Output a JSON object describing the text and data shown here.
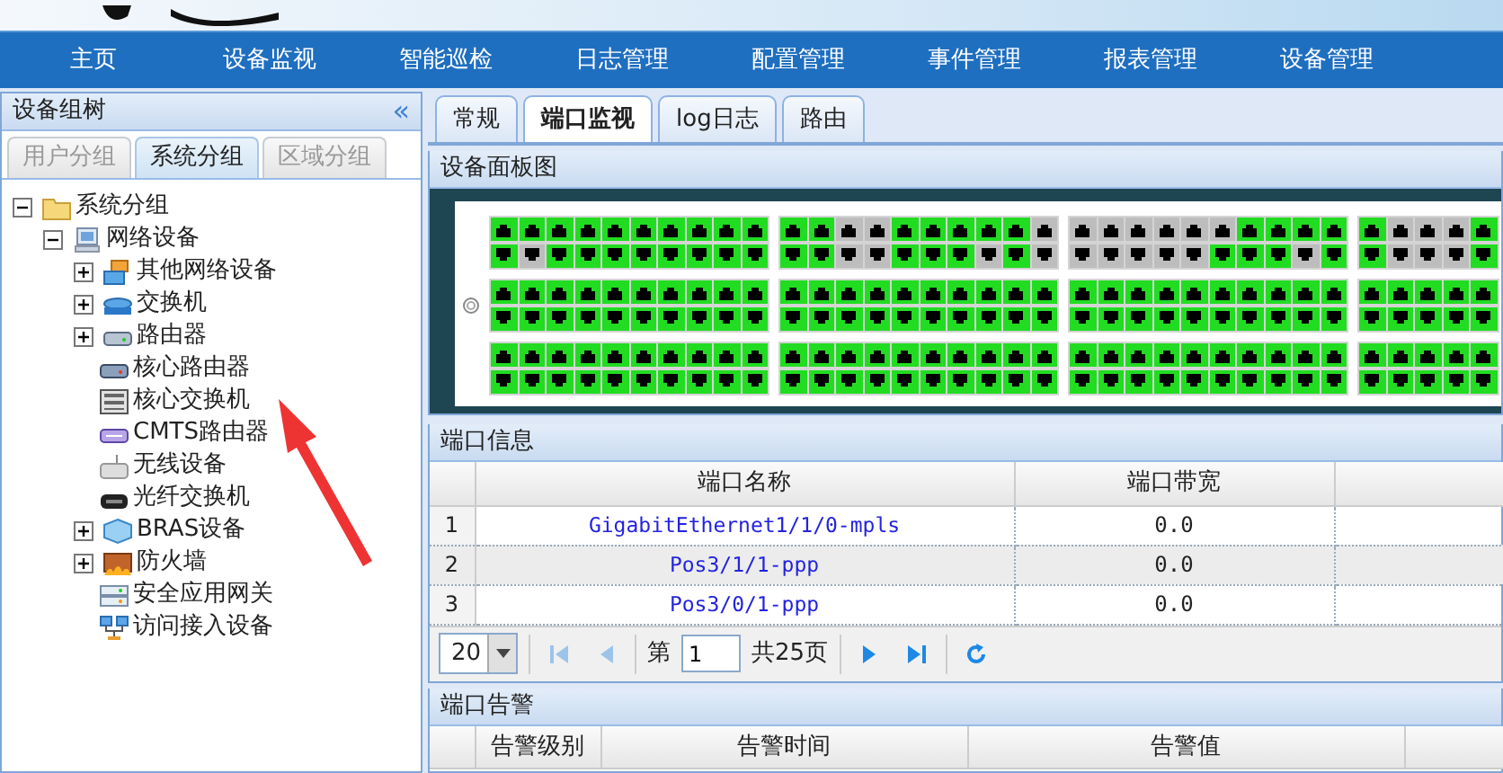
{
  "nav": [
    {
      "label": "主页"
    },
    {
      "label": "设备监视"
    },
    {
      "label": "智能巡检"
    },
    {
      "label": "日志管理"
    },
    {
      "label": "配置管理"
    },
    {
      "label": "事件管理"
    },
    {
      "label": "报表管理"
    },
    {
      "label": "设备管理"
    }
  ],
  "sidebar": {
    "title": "设备组树",
    "collapse": "«",
    "tabs": [
      {
        "label": "用户分组",
        "selected": false
      },
      {
        "label": "系统分组",
        "selected": true
      },
      {
        "label": "区域分组",
        "selected": false
      }
    ],
    "tree": [
      {
        "label": "系统分组",
        "kind": "folder",
        "expanded": true,
        "children": [
          {
            "label": "网络设备",
            "kind": "network",
            "expanded": true,
            "children": [
              {
                "label": "其他网络设备",
                "kind": "other",
                "expanded": false
              },
              {
                "label": "交换机",
                "kind": "switch",
                "expanded": false
              },
              {
                "label": "路由器",
                "kind": "router",
                "expanded": false
              },
              {
                "label": "核心路由器",
                "kind": "core-router"
              },
              {
                "label": "核心交换机",
                "kind": "core-switch"
              },
              {
                "label": "CMTS路由器",
                "kind": "cmts"
              },
              {
                "label": "无线设备",
                "kind": "wireless"
              },
              {
                "label": "光纤交换机",
                "kind": "fiber-switch"
              },
              {
                "label": "BRAS设备",
                "kind": "bras",
                "expanded": false
              },
              {
                "label": "防火墙",
                "kind": "firewall",
                "expanded": false
              },
              {
                "label": "安全应用网关",
                "kind": "gateway"
              },
              {
                "label": "访问接入设备",
                "kind": "access"
              }
            ]
          }
        ]
      }
    ]
  },
  "main": {
    "tabs": [
      {
        "label": "常规",
        "selected": false
      },
      {
        "label": "端口监视",
        "selected": true
      },
      {
        "label": "log日志",
        "selected": false
      },
      {
        "label": "路由",
        "selected": false
      }
    ],
    "panel": {
      "title": "设备面板图",
      "rows": [
        [
          {
            "top": [
              true,
              true,
              true,
              true,
              true,
              true,
              true,
              true,
              true,
              true
            ],
            "bottom": [
              true,
              false,
              true,
              true,
              true,
              true,
              true,
              true,
              true,
              true
            ]
          },
          {
            "top": [
              true,
              true,
              false,
              false,
              true,
              true,
              true,
              true,
              true,
              false
            ],
            "bottom": [
              true,
              true,
              false,
              false,
              true,
              true,
              true,
              false,
              true,
              false
            ]
          },
          {
            "top": [
              false,
              false,
              false,
              false,
              false,
              false,
              true,
              true,
              true,
              true
            ],
            "bottom": [
              false,
              false,
              false,
              false,
              false,
              true,
              true,
              true,
              false,
              true
            ]
          },
          {
            "top": [
              true,
              false,
              false,
              false,
              true
            ],
            "bottom": [
              true,
              false,
              false,
              false,
              true
            ]
          }
        ],
        [
          {
            "top": [
              true,
              true,
              true,
              true,
              true,
              true,
              true,
              true,
              true,
              true
            ],
            "bottom": [
              true,
              true,
              true,
              true,
              true,
              true,
              true,
              true,
              true,
              true
            ]
          },
          {
            "top": [
              true,
              true,
              true,
              true,
              true,
              true,
              true,
              true,
              true,
              true
            ],
            "bottom": [
              true,
              true,
              true,
              true,
              true,
              true,
              true,
              true,
              true,
              true
            ]
          },
          {
            "top": [
              true,
              true,
              true,
              true,
              true,
              true,
              true,
              true,
              true,
              true
            ],
            "bottom": [
              true,
              true,
              true,
              true,
              true,
              true,
              true,
              true,
              true,
              true
            ]
          },
          {
            "top": [
              true,
              true,
              true,
              true,
              true
            ],
            "bottom": [
              true,
              true,
              true,
              true,
              true
            ]
          }
        ],
        [
          {
            "top": [
              true,
              true,
              true,
              true,
              true,
              true,
              true,
              true,
              true,
              true
            ],
            "bottom": [
              true,
              true,
              true,
              true,
              true,
              true,
              true,
              true,
              true,
              true
            ]
          },
          {
            "top": [
              true,
              true,
              true,
              true,
              true,
              true,
              true,
              true,
              true,
              true
            ],
            "bottom": [
              true,
              true,
              true,
              true,
              true,
              true,
              true,
              true,
              true,
              true
            ]
          },
          {
            "top": [
              true,
              true,
              true,
              true,
              true,
              true,
              true,
              true,
              true,
              true
            ],
            "bottom": [
              true,
              true,
              true,
              true,
              true,
              true,
              true,
              true,
              true,
              true
            ]
          },
          {
            "top": [
              true,
              true,
              true,
              true,
              true
            ],
            "bottom": [
              true,
              true,
              true,
              true,
              true
            ]
          }
        ]
      ]
    },
    "port_info": {
      "title": "端口信息",
      "columns": [
        "端口名称",
        "端口带宽"
      ],
      "rows": [
        {
          "index": "1",
          "name": "GigabitEthernet1/1/0-mpls",
          "bandwidth": "0.0"
        },
        {
          "index": "2",
          "name": "Pos3/1/1-ppp",
          "bandwidth": "0.0"
        },
        {
          "index": "3",
          "name": "Pos3/0/1-ppp",
          "bandwidth": "0.0"
        }
      ],
      "pager": {
        "page_size": "20",
        "page_prefix": "第",
        "page": "1",
        "total": "共25页"
      }
    },
    "port_alarm": {
      "title": "端口告警",
      "columns": [
        "告警级别",
        "告警时间",
        "告警值"
      ]
    }
  }
}
